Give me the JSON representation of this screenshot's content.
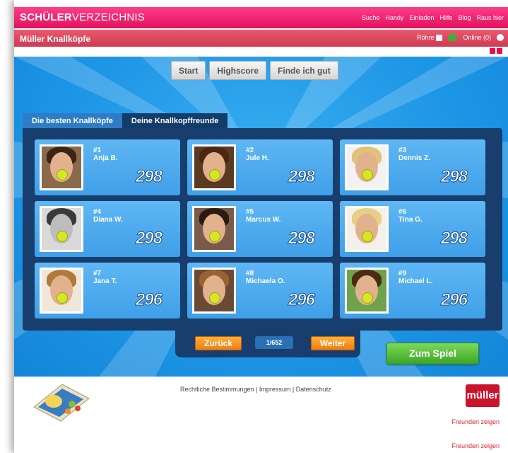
{
  "header": {
    "brand_bold": "SCHÜLER",
    "brand_thin": "VERZEICHNIS",
    "nav": [
      "Suche",
      "Handy",
      "Einladen",
      "Hilfe",
      "Blog",
      "Raus hier"
    ]
  },
  "subheader": {
    "title": "Müller Knallköpfe",
    "rohre_label": "Röhre",
    "online_label": "Online (0)"
  },
  "game": {
    "tabs": [
      "Start",
      "Highscore",
      "Finde ich gut"
    ],
    "list_tabs": [
      "Die besten Knallköpfe",
      "Deine Knallkopffreunde"
    ],
    "entries": [
      {
        "rank": "#1",
        "name": "Anja B.",
        "score": "298"
      },
      {
        "rank": "#2",
        "name": "Jule H.",
        "score": "298"
      },
      {
        "rank": "#3",
        "name": "Dennis Z.",
        "score": "298"
      },
      {
        "rank": "#4",
        "name": "Diana W.",
        "score": "298"
      },
      {
        "rank": "#5",
        "name": "Marcus W.",
        "score": "298"
      },
      {
        "rank": "#6",
        "name": "Tina G.",
        "score": "298"
      },
      {
        "rank": "#7",
        "name": "Jana T.",
        "score": "296"
      },
      {
        "rank": "#8",
        "name": "Michaela O.",
        "score": "296"
      },
      {
        "rank": "#9",
        "name": "Michael L.",
        "score": "296"
      }
    ],
    "pager": {
      "back": "Zurück",
      "count": "1/652",
      "next": "Weiter"
    },
    "play_button": "Zum Spiel"
  },
  "footer": {
    "links": [
      "Rechtliche Bestimmungen",
      "Impressum",
      "Datenschutz"
    ],
    "separator": " | ",
    "logo_text": "müller",
    "share_1": "Freunden zeigen",
    "share_2": "Freunden zeigen"
  },
  "colors": {
    "topbar": "#e2115f",
    "subbar": "#d23a52",
    "game_blue": "#1d95e6",
    "panel_navy": "#173e6c",
    "orange_button": "#f07d12",
    "green_button": "#3da526",
    "muller_red": "#c9142b"
  }
}
